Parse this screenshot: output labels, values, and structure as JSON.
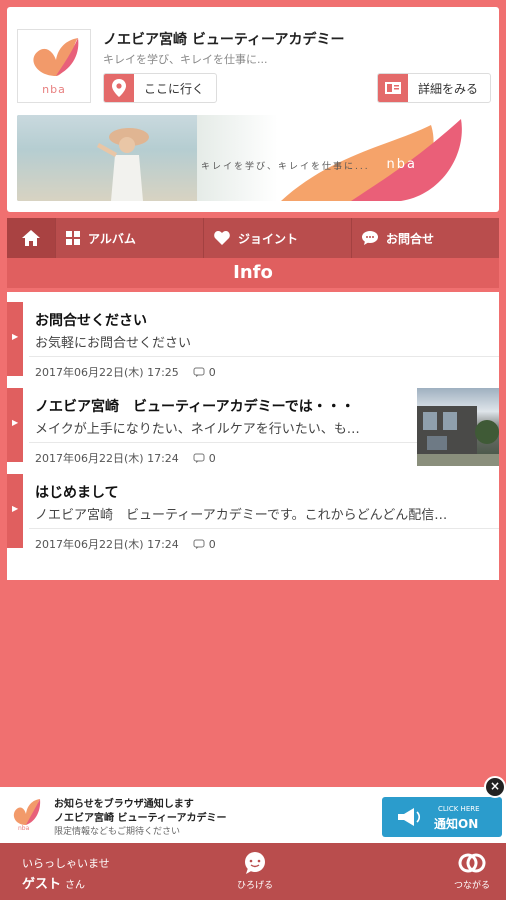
{
  "shop": {
    "title": "ノエビア宮崎 ビューティーアカデミー",
    "subtitle": "キレイを学び、キレイを仕事に...",
    "logo_text": "nba",
    "go_label": "ここに行く",
    "detail_label": "詳細をみる",
    "banner_tagline": "キレイを学び、キレイを仕事に...",
    "banner_brand": "nba"
  },
  "nav": {
    "items": [
      {
        "label": "アルバム",
        "icon": "grid-icon"
      },
      {
        "label": "ジョイント",
        "icon": "heart-icon"
      },
      {
        "label": "お問合せ",
        "icon": "chat-icon"
      }
    ]
  },
  "info": {
    "heading": "Info",
    "items": [
      {
        "title": "お問合せください",
        "desc": "お気軽にお問合せください",
        "date": "2017年06月22日(木) 17:25",
        "comments": "0"
      },
      {
        "title": "ノエビア宮崎　ビューティーアカデミーでは・・・",
        "desc": "メイクが上手になりたい、ネイルケアを行いたい、も…",
        "date": "2017年06月22日(木) 17:24",
        "comments": "0"
      },
      {
        "title": "はじめまして",
        "desc": "ノエビア宮崎　ビューティーアカデミーです。これからどんどん配信…",
        "date": "2017年06月22日(木) 17:24",
        "comments": "0"
      }
    ]
  },
  "notify": {
    "line1": "お知らせをブラウザ通知します",
    "line2": "ノエビア宮崎 ビューティーアカデミー",
    "line3": "限定情報などもご期待ください",
    "btn_small": "CLICK HERE",
    "btn_main": "通知ON"
  },
  "footer": {
    "greeting": "いらっしゃいませ",
    "user": "ゲスト",
    "honorific": "さん",
    "spread_label": "ひろげる",
    "connect_label": "つながる"
  },
  "colors": {
    "accent": "#e05f5f",
    "nav": "#b94d4d",
    "background": "#f07070",
    "notify_button": "#2b9ccc"
  }
}
